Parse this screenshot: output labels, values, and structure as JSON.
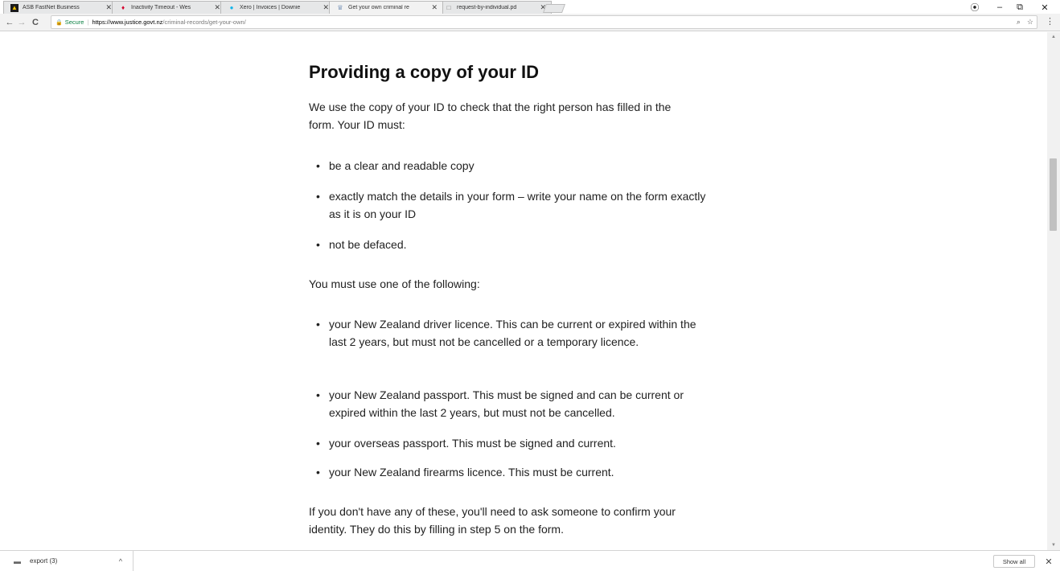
{
  "browser": {
    "tabs": [
      {
        "title": "ASB FastNet Business",
        "icon": "asb-favicon",
        "color": "#1a1a1a",
        "glyph": "▲"
      },
      {
        "title": "Inactivity Timeout - Wes",
        "icon": "westpac-favicon",
        "color": "#d5002b",
        "glyph": "♦"
      },
      {
        "title": "Xero | Invoices | Downie",
        "icon": "xero-favicon",
        "color": "#13b5ea",
        "glyph": "●"
      },
      {
        "title": "Get your own criminal re",
        "icon": "nz-govt-crest-favicon",
        "color": "#1f4e8c",
        "glyph": "♕"
      },
      {
        "title": "request-by-individual.pd",
        "icon": "document-favicon",
        "color": "#777777",
        "glyph": "□"
      }
    ],
    "active_tab": 3,
    "window_controls": {
      "profile": "⦿",
      "minimize": "–",
      "restore": "⧉",
      "close": "✕"
    },
    "nav": {
      "back": "←",
      "forward": "→",
      "reload": "C"
    },
    "address": {
      "secure_label": "Secure",
      "url_scheme_host": "https://www.justice.govt.nz",
      "url_path": "/criminal-records/get-your-own/"
    },
    "omnibox_icons": {
      "zoom": "⌕",
      "bookmark": "☆"
    },
    "menu": "⋮"
  },
  "article": {
    "heading": "Providing a copy of your ID",
    "intro": "We use the copy of your ID to check that the right person has filled in the form. Your ID must:",
    "requirements": [
      "be a clear and readable copy",
      "exactly match the details in your form – write your name on the form exactly as it is on your ID",
      "not be defaced."
    ],
    "options_intro": "You must use one of the following:",
    "options": [
      "your New Zealand driver licence. This can be current or expired within the last 2 years, but must not be cancelled or a temporary licence.",
      "your New Zealand passport. This must be signed and can be current or expired within the last 2 years, but must not be cancelled.",
      "your overseas passport. This must be signed and current.",
      "your New Zealand firearms licence. This must be current."
    ],
    "fallback": "If you don't have any of these, you'll need to ask someone to confirm your identity. They do this by filling in step 5 on the form."
  },
  "download_bar": {
    "file_name": "export (3)",
    "show_all_label": "Show all",
    "close": "✕"
  }
}
